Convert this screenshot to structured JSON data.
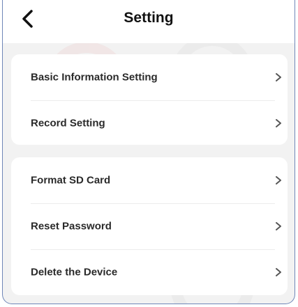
{
  "header": {
    "title": "Setting",
    "back_icon": "chevron-left-icon"
  },
  "groups": [
    {
      "items": [
        {
          "label": "Basic Information Setting",
          "icon": "chevron-right-icon"
        },
        {
          "label": "Record Setting",
          "icon": "chevron-right-icon"
        }
      ]
    },
    {
      "items": [
        {
          "label": "Format SD Card",
          "icon": "chevron-right-icon"
        },
        {
          "label": "Reset Password",
          "icon": "chevron-right-icon"
        },
        {
          "label": "Delete the Device",
          "icon": "chevron-right-icon"
        }
      ]
    }
  ],
  "colors": {
    "background": "#f2f2f2",
    "card": "#ffffff",
    "text": "#2a2a2a",
    "frame_border": "#6f86b8",
    "watermark": "#e23a3a"
  }
}
